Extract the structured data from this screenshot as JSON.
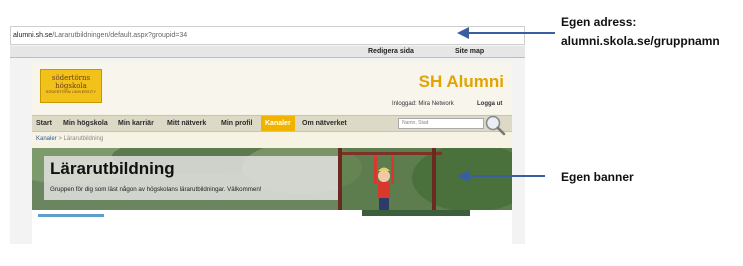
{
  "browser": {
    "address_host": "alumni.sh.se",
    "address_path": "/Lararutbildningen/default.aspx?groupid=34"
  },
  "topbar": {
    "edit_label": "Redigera sida",
    "sitemap_label": "Site map"
  },
  "header": {
    "logo_line1": "södertörns",
    "logo_line2": "högskola",
    "logo_line3": "SÖDERTÖRN UNIVERSITY",
    "site_title": "SH Alumni",
    "logged_in": "Inloggad: Mira Network",
    "logout": "Logga ut"
  },
  "nav": {
    "items": [
      "Start",
      "Min högskola",
      "Min karriär",
      "Mitt nätverk",
      "Min profil",
      "Kanaler",
      "Om nätverket"
    ],
    "active": "Kanaler",
    "search_placeholder": "Namn, Stad"
  },
  "breadcrumb": {
    "first": "Kanaler",
    "separator": " > ",
    "current": "Lärarutbildning"
  },
  "banner": {
    "title": "Lärarutbildning",
    "text": "Gruppen för dig som läst någon av högskolans lärarutbildningar. Välkommen!"
  },
  "annotations": {
    "address_line1": "Egen adress:",
    "address_line2": "alumni.skola.se/gruppnamn",
    "banner": "Egen banner"
  },
  "colors": {
    "accent": "#f0b400",
    "arrow": "#3a5fa0",
    "banner_green": "#66805a"
  }
}
